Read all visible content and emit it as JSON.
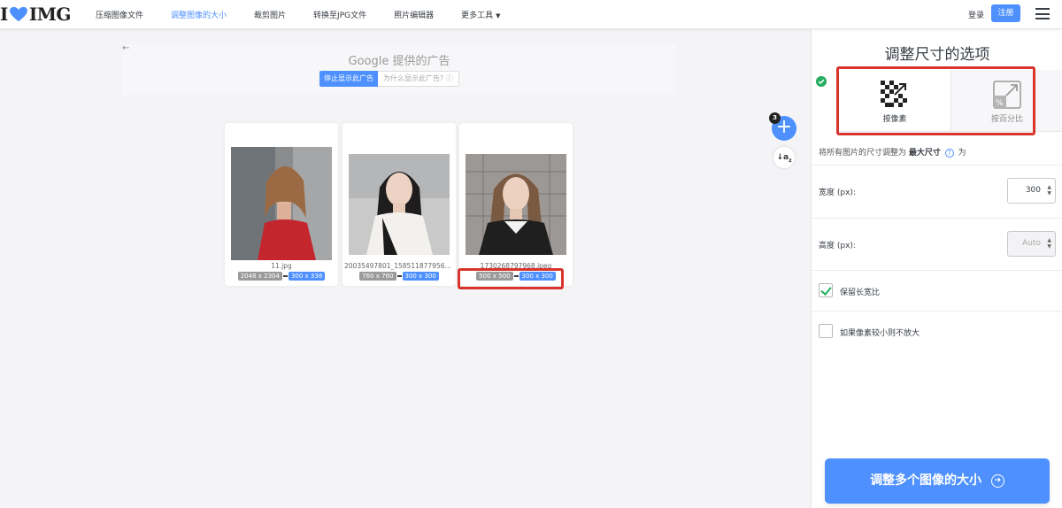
{
  "header": {
    "logo_left": "I",
    "logo_right": "IMG",
    "nav": [
      {
        "label": "压缩图像文件"
      },
      {
        "label": "调整图像的大小"
      },
      {
        "label": "裁剪图片"
      },
      {
        "label": "转换至JPG文件"
      },
      {
        "label": "照片编辑器"
      },
      {
        "label": "更多工具"
      }
    ],
    "active_nav": "调整图像的大小",
    "login": "登录",
    "signup": "注册"
  },
  "ad": {
    "title": "Google 提供的广告",
    "stop": "停止显示此广告",
    "why": "为什么显示此广告?"
  },
  "files": [
    {
      "name": "11.jpg",
      "original": "2048 x 2304",
      "resized": "300 x 338"
    },
    {
      "name": "20035497801_158511877956_1…",
      "original": "760 x 760",
      "resized": "300 x 300"
    },
    {
      "name": "1730268797968.jpeg",
      "original": "500 x 500",
      "resized": "300 x 300"
    }
  ],
  "file_count": "3",
  "panel": {
    "title": "调整尺寸的选项",
    "mode_pixel": "按像素",
    "mode_percent": "按百分比",
    "desc_prefix": "将所有图片的尺寸调整为",
    "desc_bold": "最大尺寸",
    "desc_suffix": "为",
    "width_label": "宽度 (px):",
    "width_value": "300",
    "height_label": "高度 (px):",
    "height_value": "Auto",
    "keep_ratio": "保留长宽比",
    "keep_ratio_checked": true,
    "no_enlarge": "如果像素较小则不放大",
    "no_enlarge_checked": false,
    "submit": "调整多个图像的大小"
  },
  "colors": {
    "accent": "#4d90fe",
    "highlight": "#d9342b",
    "success": "#27ae60"
  }
}
